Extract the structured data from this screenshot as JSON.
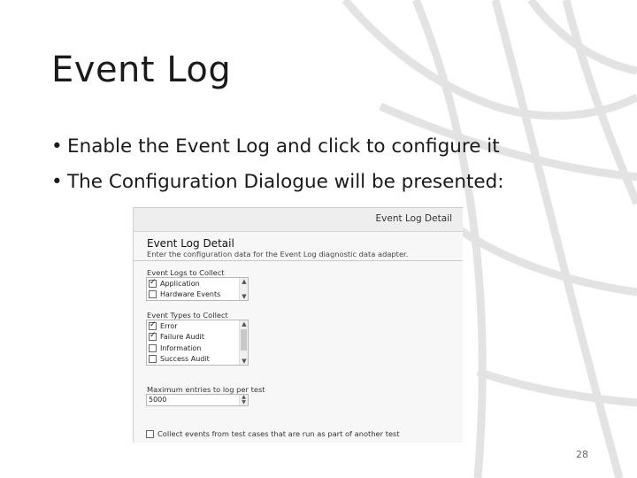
{
  "slide": {
    "title": "Event Log",
    "bullets": [
      "Enable the Event Log and click to configure it",
      "The Configuration Dialogue will be presented:"
    ],
    "page_number": "28"
  },
  "dialog": {
    "tab_title": "Event Log Detail",
    "heading": "Event Log Detail",
    "description": "Enter the configuration data for the Event Log diagnostic data adapter.",
    "logs_label": "Event Logs to Collect",
    "logs": [
      {
        "label": "Application",
        "checked": true
      },
      {
        "label": "Hardware Events",
        "checked": false
      }
    ],
    "types_label": "Event Types to Collect",
    "types": [
      {
        "label": "Error",
        "checked": true
      },
      {
        "label": "Failure Audit",
        "checked": true
      },
      {
        "label": "Information",
        "checked": false
      },
      {
        "label": "Success Audit",
        "checked": false
      }
    ],
    "max_entries_label": "Maximum entries to log per test",
    "max_entries_value": "5000",
    "collect_label": "Collect events from test cases that are run as part of another test",
    "collect_checked": false
  }
}
